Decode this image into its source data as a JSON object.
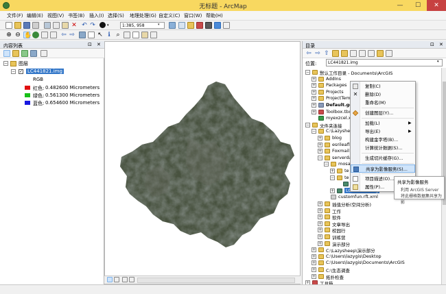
{
  "window": {
    "title": "无标题 - ArcMap",
    "min": "—",
    "max": "☐",
    "close": "✕"
  },
  "menu": [
    "文件(F)",
    "编辑(E)",
    "视图(V)",
    "书签(B)",
    "插入(I)",
    "选择(S)",
    "地理处理(G)",
    "自定义(C)",
    "窗口(W)",
    "帮助(H)"
  ],
  "toolbar": {
    "scale_value": "1:385, 958"
  },
  "toc": {
    "title": "内容列表",
    "pin": "⊡",
    "close": "✕",
    "layers_root": "图层",
    "layer_name": "LC441821.img",
    "rgb_label": "RGB",
    "bands": [
      {
        "label": "红色:",
        "value": "0.482600 Micrometers",
        "color": "#e01010"
      },
      {
        "label": "绿色:",
        "value": "0.561300 Micrometers",
        "color": "#18c018"
      },
      {
        "label": "蓝色:",
        "value": "0.654600 Micrometers",
        "color": "#1818e0"
      }
    ]
  },
  "catalog": {
    "title": "目录",
    "pin": "⊡",
    "close": "✕",
    "location_label": "位置:",
    "location_value": "LC441821.img",
    "tree": [
      {
        "label": "默认工作目录 - Documents\\ArcGIS",
        "level": 1,
        "exp": "−",
        "icon": "home"
      },
      {
        "label": "AddIns",
        "level": 2,
        "exp": "+",
        "icon": "folder"
      },
      {
        "label": "Packages",
        "level": 2,
        "exp": "+",
        "icon": "folder"
      },
      {
        "label": "Projects",
        "level": 2,
        "exp": "+",
        "icon": "folder"
      },
      {
        "label": "ProjectTemp",
        "level": 2,
        "exp": "+",
        "icon": "folder"
      },
      {
        "label": "Default.gdb",
        "level": 2,
        "exp": "+",
        "icon": "gdb",
        "bold": true
      },
      {
        "label": "Toolbox.tbx",
        "level": 2,
        "exp": "+",
        "icon": "toolbox"
      },
      {
        "label": "myexzcel.xls",
        "level": 2,
        "exp": "",
        "icon": "xls"
      },
      {
        "label": "文件夹连接",
        "level": 1,
        "exp": "−",
        "icon": "folder"
      },
      {
        "label": "C:\\Lazysheep",
        "level": 2,
        "exp": "−",
        "icon": "folder"
      },
      {
        "label": "blog",
        "level": 3,
        "exp": "+",
        "icon": "folder"
      },
      {
        "label": "esrileaflet",
        "level": 3,
        "exp": "+",
        "icon": "folder"
      },
      {
        "label": "Foxmail 7",
        "level": 3,
        "exp": "+",
        "icon": "folder"
      },
      {
        "label": "serverdata",
        "level": 3,
        "exp": "−",
        "icon": "folder"
      },
      {
        "label": "mosa",
        "level": 4,
        "exp": "−",
        "icon": "folder"
      },
      {
        "label": "te",
        "level": 5,
        "exp": "+",
        "icon": "folder"
      },
      {
        "label": "te",
        "level": 5,
        "exp": "−",
        "icon": "folder"
      },
      {
        "label": "",
        "level": 6,
        "exp": "",
        "icon": "raster"
      },
      {
        "label": "LC441821.img",
        "level": 5,
        "exp": "+",
        "icon": "raster",
        "selected": true
      },
      {
        "label": "customfun.rft.xml",
        "level": 4,
        "exp": "",
        "icon": "xml"
      },
      {
        "label": "插值分析(空间分析)",
        "level": 3,
        "exp": "+",
        "icon": "folder"
      },
      {
        "label": "工作",
        "level": 3,
        "exp": "+",
        "icon": "folder"
      },
      {
        "label": "软件",
        "level": 3,
        "exp": "+",
        "icon": "folder"
      },
      {
        "label": "文章导出",
        "level": 3,
        "exp": "+",
        "icon": "folder"
      },
      {
        "label": "校园行",
        "level": 3,
        "exp": "+",
        "icon": "folder"
      },
      {
        "label": "训练营",
        "level": 3,
        "exp": "+",
        "icon": "folder"
      },
      {
        "label": "演示部分",
        "level": 3,
        "exp": "+",
        "icon": "folder"
      },
      {
        "label": "C:\\Lazysheep\\演示部分",
        "level": 2,
        "exp": "+",
        "icon": "folder"
      },
      {
        "label": "C:\\Users\\lazygis\\Desktop",
        "level": 2,
        "exp": "+",
        "icon": "folder"
      },
      {
        "label": "C:\\Users\\lazygis\\Documents\\ArcGIS",
        "level": 2,
        "exp": "+",
        "icon": "folder"
      },
      {
        "label": "C:\\生态调查",
        "level": 2,
        "exp": "+",
        "icon": "folder"
      },
      {
        "label": "拓扑检查",
        "level": 2,
        "exp": "+",
        "icon": "folder"
      },
      {
        "label": "工具箱",
        "level": 1,
        "exp": "+",
        "icon": "toolbox"
      }
    ]
  },
  "context_menu": [
    {
      "label": "复制(C)",
      "icon": "copy"
    },
    {
      "label": "删除(D)",
      "icon": "delete"
    },
    {
      "label": "重命名(M)",
      "icon": ""
    },
    {
      "sep": true
    },
    {
      "label": "创建图层(Y)...",
      "icon": "layer"
    },
    {
      "sep": true
    },
    {
      "label": "加载(L)",
      "icon": "",
      "submenu": true
    },
    {
      "label": "导出(E)",
      "icon": "",
      "submenu": true
    },
    {
      "label": "构建金字塔(B)...",
      "icon": ""
    },
    {
      "label": "计算统计数据(S)...",
      "icon": ""
    },
    {
      "sep": true
    },
    {
      "label": "生成切片缓存(G)...",
      "icon": ""
    },
    {
      "sep": true
    },
    {
      "label": "共享为影像服务(S)...",
      "icon": "share",
      "highlight": true
    },
    {
      "sep": true
    },
    {
      "label": "项目描述(O)...",
      "icon": "describe"
    },
    {
      "label": "属性(P)...",
      "icon": "properties"
    }
  ],
  "tooltip": {
    "title": "共享为影像服务",
    "desc1": "利用 ArcGIS Server",
    "desc2": "将此栅格数据集共享为影"
  },
  "colors": {
    "titlebar": "#f8d860",
    "selection": "#3276c8",
    "menu_highlight": "#cfe4fa"
  }
}
